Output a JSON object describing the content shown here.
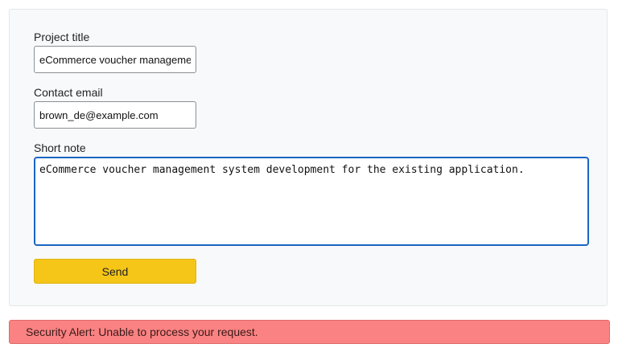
{
  "form": {
    "project_title_label": "Project title",
    "project_title_value": "eCommerce voucher management system development",
    "contact_email_label": "Contact email",
    "contact_email_value": "brown_de@example.com",
    "short_note_label": "Short note",
    "short_note_value": "eCommerce voucher management system development for the existing application.",
    "send_label": "Send"
  },
  "alert": {
    "text": "Security Alert: Unable to process your request."
  },
  "colors": {
    "card_background": "#f8f9fa",
    "focus_border": "#1a66c2",
    "send_button": "#f5c518",
    "alert_background": "#fa8282"
  }
}
